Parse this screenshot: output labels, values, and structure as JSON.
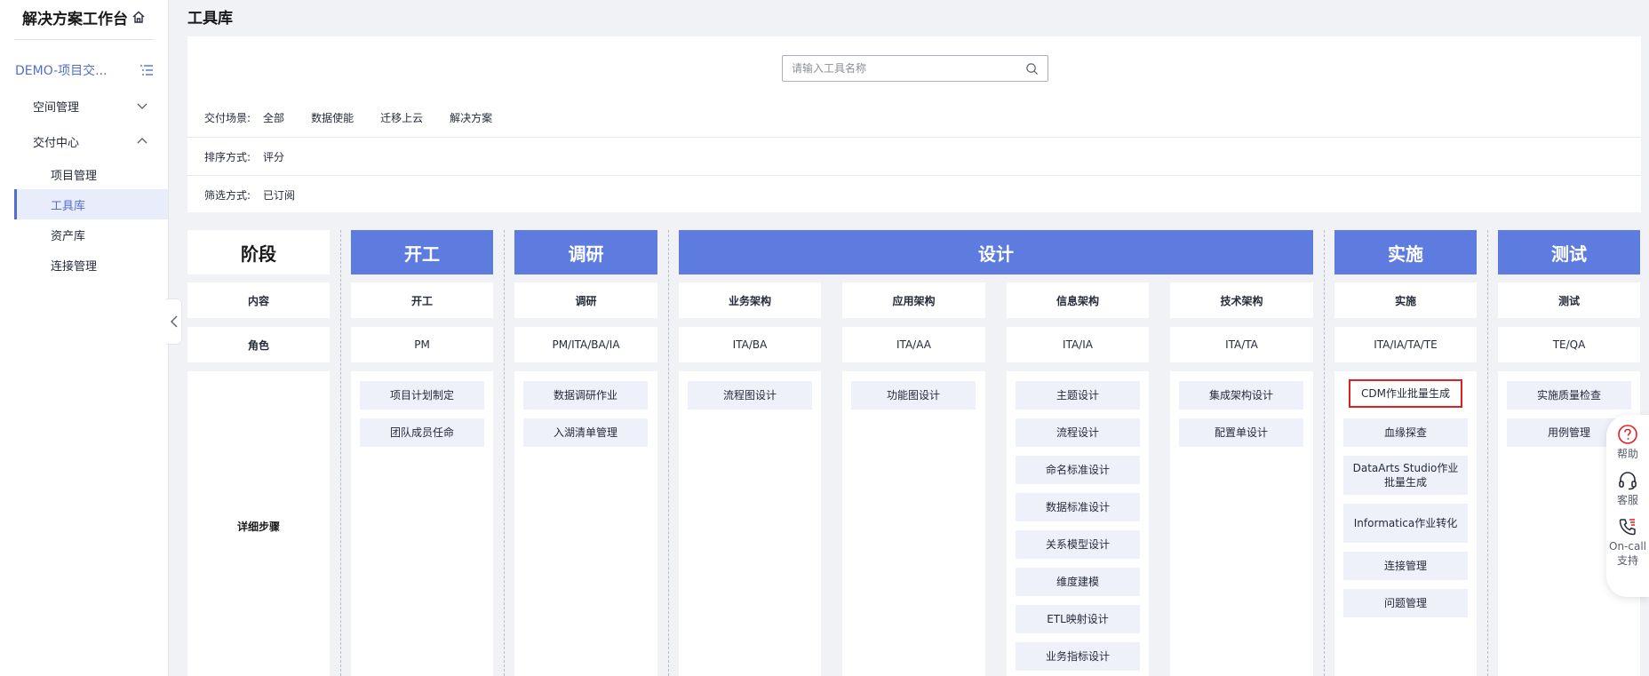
{
  "sidebar": {
    "title": "解决方案工作台",
    "project": "DEMO-项目交...",
    "menu": [
      {
        "label": "空间管理"
      },
      {
        "label": "交付中心"
      }
    ],
    "sub_items": [
      {
        "label": "项目管理"
      },
      {
        "label": "工具库"
      },
      {
        "label": "资产库"
      },
      {
        "label": "连接管理"
      }
    ]
  },
  "page": {
    "title": "工具库"
  },
  "search": {
    "placeholder": "请输入工具名称"
  },
  "filters": {
    "scene_label": "交付场景:",
    "scene_options": [
      "全部",
      "数据使能",
      "迁移上云",
      "解决方案"
    ],
    "sort_label": "排序方式:",
    "sort_value": "评分",
    "filter_label": "筛选方式:",
    "filter_value": "已订阅"
  },
  "board": {
    "label_column": {
      "stage": "阶段",
      "content": "内容",
      "role": "角色",
      "steps": "详细步骤"
    },
    "stages": [
      "开工",
      "调研",
      "设计",
      "实施",
      "测试"
    ],
    "columns": [
      {
        "content": "开工",
        "role": "PM",
        "tools": [
          "项目计划制定",
          "团队成员任命"
        ]
      },
      {
        "content": "调研",
        "role": "PM/ITA/BA/IA",
        "tools": [
          "数据调研作业",
          "入湖清单管理"
        ]
      },
      {
        "content": "业务架构",
        "role": "ITA/BA",
        "tools": [
          "流程图设计"
        ]
      },
      {
        "content": "应用架构",
        "role": "ITA/AA",
        "tools": [
          "功能图设计"
        ]
      },
      {
        "content": "信息架构",
        "role": "ITA/IA",
        "tools": [
          "主题设计",
          "流程设计",
          "命名标准设计",
          "数据标准设计",
          "关系模型设计",
          "维度建模",
          "ETL映射设计",
          "业务指标设计"
        ]
      },
      {
        "content": "技术架构",
        "role": "ITA/TA",
        "tools": [
          "集成架构设计",
          "配置单设计"
        ]
      },
      {
        "content": "实施",
        "role": "ITA/IA/TA/TE",
        "tools": [
          "CDM作业批量生成",
          "血缘探查",
          "DataArts Studio作业批量生成",
          "Informatica作业转化",
          "连接管理",
          "问题管理"
        ]
      },
      {
        "content": "测试",
        "role": "TE/QA",
        "tools": [
          "实施质量检查",
          "用例管理"
        ]
      }
    ]
  },
  "float_help": [
    {
      "label": "帮助",
      "icon": "question-icon"
    },
    {
      "label": "客服",
      "icon": "headset-icon"
    },
    {
      "label": "On-call\n支持",
      "icon": "phone-icon"
    }
  ]
}
